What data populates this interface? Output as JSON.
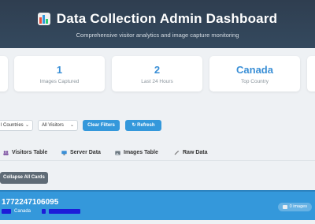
{
  "header": {
    "title": "Data Collection Admin Dashboard",
    "subtitle": "Comprehensive visitor analytics and image capture monitoring"
  },
  "stats": [
    {
      "value": "1",
      "label": "Images Captured"
    },
    {
      "value": "2",
      "label": "Last 24 Hours"
    },
    {
      "value": "Canada",
      "label": "Top Country"
    }
  ],
  "filters": {
    "country_select": "l Countries",
    "visitor_select": "All Visitors",
    "clear_label": "Clear Filters",
    "refresh_label": "Refresh",
    "refresh_icon": "refresh-icon"
  },
  "tabs": [
    {
      "label": "Visitors Table",
      "icon": "users-icon"
    },
    {
      "label": "Server Data",
      "icon": "monitor-icon"
    },
    {
      "label": "Images Table",
      "icon": "image-icon"
    },
    {
      "label": "Raw Data",
      "icon": "wrench-icon"
    }
  ],
  "collapse_label": "Collapse All Cards",
  "card": {
    "id": "1772247106095",
    "country": "Canada",
    "images_badge": "0 images"
  },
  "colors": {
    "accent": "#3498db",
    "header_bg": "#34495e",
    "collapse_bg": "#5f6b76"
  }
}
